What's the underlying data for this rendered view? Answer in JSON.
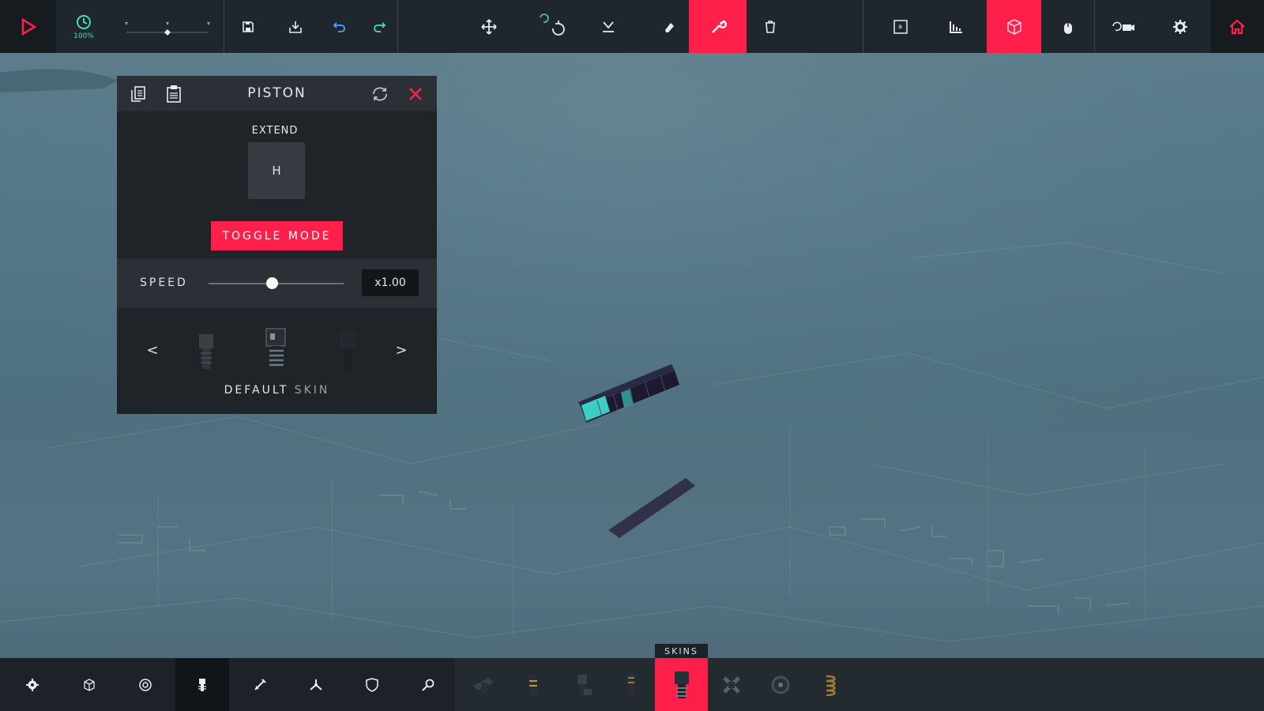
{
  "toolbar": {
    "time_scale_label": "100%",
    "buttons": {
      "play": "play-icon",
      "time_scale": "clock-icon",
      "save": "floppy-disk-icon",
      "load": "import-icon",
      "undo": "undo-icon",
      "redo": "redo-icon",
      "move": "move-arrows-icon",
      "rotate": "rotate-icon",
      "snap": "snap-down-icon",
      "eraser": "eraser-icon",
      "wrench": "wrench-icon",
      "delete": "trash-icon",
      "hud": "hud-icon",
      "stats": "bar-chart-icon",
      "block_view": "cube-outline-icon",
      "mouse_mode": "mouse-icon",
      "camera": "camera-icon",
      "settings": "gear-icon",
      "home": "home-icon"
    },
    "active": [
      "wrench",
      "block_view"
    ]
  },
  "panel": {
    "title": "PISTON",
    "extend_label": "EXTEND",
    "extend_key": "H",
    "toggle_button": "TOGGLE MODE",
    "speed_label": "SPEED",
    "speed_value": "x1.00",
    "speed_slider_fraction": 0.47,
    "skin_prev": "<",
    "skin_next": ">",
    "skin_name_main": "DEFAULT",
    "skin_name_suffix": "SKIN"
  },
  "bottombar": {
    "categories": [
      "cog-icon",
      "cube-icon",
      "gear-wheel-icon",
      "piston-icon",
      "sword-icon",
      "propeller-icon",
      "shield-icon",
      "magnifier-icon"
    ],
    "selected_category": 3,
    "skins_label": "SKINS",
    "blocks": [
      "spinner-block-icon",
      "grabber-block-icon",
      "steering-block-icon",
      "suspension-block-icon",
      "piston-block-icon",
      "wheel-block-icon",
      "cog-block-icon",
      "spring-block-icon"
    ],
    "selected_block": 4
  },
  "colors": {
    "accent": "#ff1f4b",
    "toolbar_bg": "#1f262d",
    "panel_bg": "#1f2429",
    "ground": "#527282",
    "glow": "#3fe0d6"
  }
}
